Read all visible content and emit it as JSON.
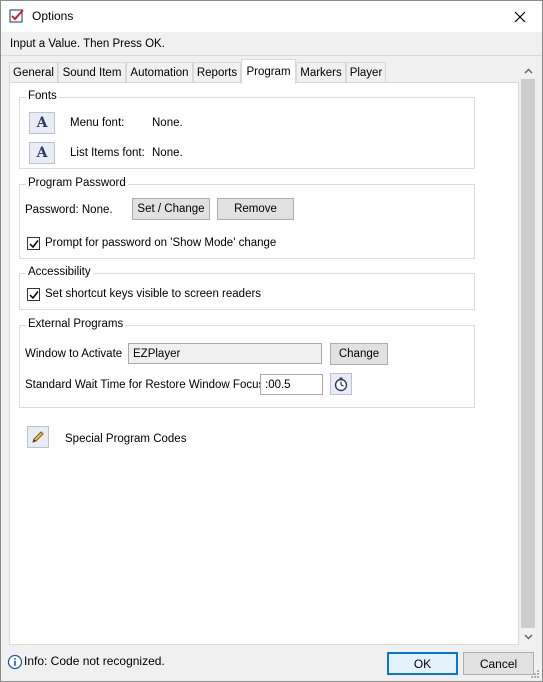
{
  "window": {
    "title": "Options"
  },
  "prompt": {
    "text": "Input a Value. Then Press OK."
  },
  "tabs": [
    {
      "label": "General"
    },
    {
      "label": "Sound Item"
    },
    {
      "label": "Automation"
    },
    {
      "label": "Reports"
    },
    {
      "label": "Program",
      "active": true
    },
    {
      "label": "Markers"
    },
    {
      "label": "Player"
    }
  ],
  "fonts": {
    "title": "Fonts",
    "button_glyph": "A",
    "menu_font_label": "Menu font:",
    "menu_font_value": "None.",
    "list_font_label": "List Items font:",
    "list_font_value": "None."
  },
  "password": {
    "title": "Program Password",
    "status_text": "Password: None.",
    "set_change_label": "Set / Change",
    "remove_label": "Remove",
    "prompt_checkbox_label": "Prompt for password on 'Show Mode' change",
    "prompt_checked": true
  },
  "accessibility": {
    "title": "Accessibility",
    "checkbox_label": "Set shortcut keys visible to screen readers",
    "checked": true
  },
  "external": {
    "title": "External Programs",
    "window_label": "Window to Activate",
    "window_value": "EZPlayer",
    "change_label": "Change",
    "wait_label": "Standard Wait Time for Restore Window Focus",
    "wait_value": ":00.5"
  },
  "special": {
    "label": "Special Program Codes"
  },
  "status": {
    "text": "Info: Code not recognized.",
    "ok_label": "OK",
    "cancel_label": "Cancel"
  },
  "colors": {
    "accent": "#0078d7",
    "window_bg": "#f0f0f0",
    "page_bg": "#ffffff"
  }
}
